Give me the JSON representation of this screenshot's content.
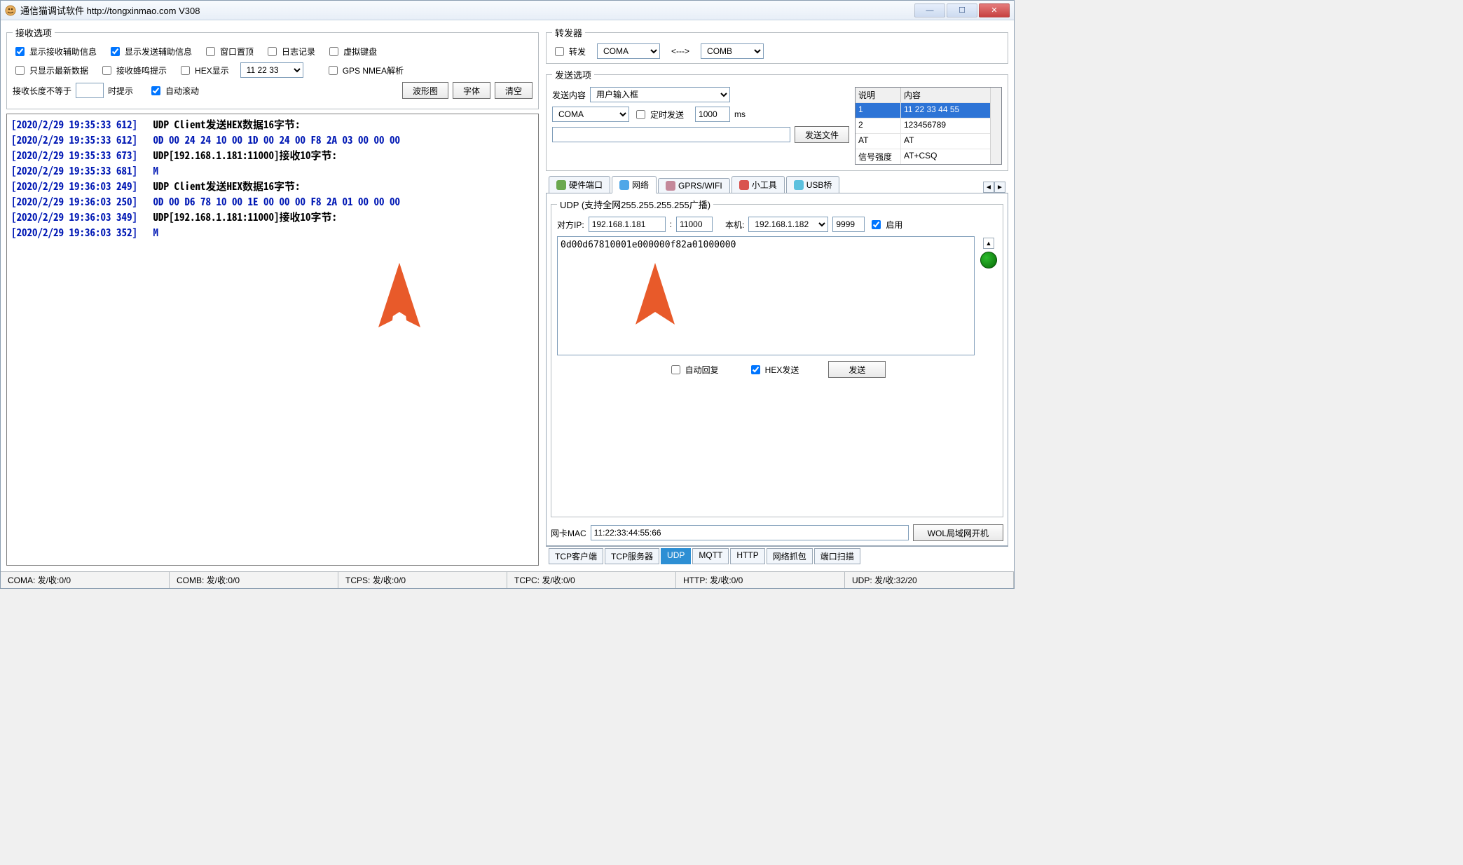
{
  "window": {
    "title": "通信猫调试软件  http://tongxinmao.com  V308"
  },
  "recv_options": {
    "legend": "接收选项",
    "show_recv_aux": "显示接收辅助信息",
    "show_send_aux": "显示发送辅助信息",
    "topmost": "窗口置顶",
    "logrec": "日志记录",
    "virtual_kb": "虚拟键盘",
    "only_newest": "只显示最新数据",
    "recv_beep": "接收蜂鸣提示",
    "hex_disp": "HEX显示",
    "hex_sample": "11 22 33",
    "gps_nmea": "GPS NMEA解析",
    "len_ne_label": "接收长度不等于",
    "len_ne_value": "",
    "len_hint": "时提示",
    "autoscroll": "自动滚动",
    "btn_wave": "波形图",
    "btn_font": "字体",
    "btn_clear": "清空"
  },
  "log_lines": [
    {
      "type": "hdr",
      "ts": "[2020/2/29 19:35:33 612]",
      "text": "UDP Client发送HEX数据16字节:"
    },
    {
      "type": "hex",
      "ts": "[2020/2/29 19:35:33 612]",
      "text": "0D 00 24 24 10 00 1D 00 24 00 F8 2A 03 00 00 00"
    },
    {
      "type": "hdr",
      "ts": "[2020/2/29 19:35:33 673]",
      "text": "UDP[192.168.1.181:11000]接收10字节:"
    },
    {
      "type": "m",
      "ts": "[2020/2/29 19:35:33 681]",
      "text": "M"
    },
    {
      "type": "hdr",
      "ts": "[2020/2/29 19:36:03 249]",
      "text": "UDP Client发送HEX数据16字节:"
    },
    {
      "type": "hex",
      "ts": "[2020/2/29 19:36:03 250]",
      "text": "0D 00 D6 78 10 00 1E 00 00 00 F8 2A 01 00 00 00"
    },
    {
      "type": "hdr",
      "ts": "[2020/2/29 19:36:03 349]",
      "text": "UDP[192.168.1.181:11000]接收10字节:"
    },
    {
      "type": "m",
      "ts": "[2020/2/29 19:36:03 352]",
      "text": "M"
    }
  ],
  "forwarder": {
    "legend": "转发器",
    "enable": "转发",
    "from": "COMA",
    "arrow": "<--->",
    "to": "COMB"
  },
  "send_options": {
    "legend": "发送选项",
    "content_lbl": "发送内容",
    "content_sel": "用户输入框",
    "port_sel": "COMA",
    "timed_lbl": "定时发送",
    "timed_val": "1000",
    "ms": "ms",
    "sendfile_btn": "发送文件",
    "file_input": "",
    "table_header_desc": "说明",
    "table_header_content": "内容",
    "rows": [
      {
        "desc": "1",
        "content": "11 22 33 44 55"
      },
      {
        "desc": "2",
        "content": "123456789"
      },
      {
        "desc": "AT",
        "content": "AT"
      },
      {
        "desc": "信号强度",
        "content": "AT+CSQ"
      }
    ]
  },
  "tabs": {
    "hw": "硬件端口",
    "net": "网络",
    "gprs": "GPRS/WIFI",
    "tool": "小工具",
    "usb": "USB桥"
  },
  "subtabs": {
    "tcpc": "TCP客户端",
    "tcps": "TCP服务器",
    "udp": "UDP",
    "mqtt": "MQTT",
    "http": "HTTP",
    "cap": "网络抓包",
    "scan": "端口扫描"
  },
  "udp": {
    "legend": "UDP (支持全网255.255.255.255广播)",
    "remote_ip_lbl": "对方IP:",
    "remote_ip": "192.168.1.181",
    "remote_port": "11000",
    "local_lbl": "本机:",
    "local_ip": "192.168.1.182",
    "local_port": "9999",
    "enable": "启用",
    "data": "0d00d67810001e000000f82a01000000",
    "auto_reply": "自动回复",
    "hex_send": "HEX发送",
    "send_btn": "发送",
    "mac_lbl": "网卡MAC",
    "mac_val": "11:22:33:44:55:66",
    "wol_btn": "WOL局域网开机"
  },
  "status": {
    "coma": "COMA: 发/收:0/0",
    "comb": "COMB: 发/收:0/0",
    "tcps": "TCPS: 发/收:0/0",
    "tcpc": "TCPC: 发/收:0/0",
    "http": "HTTP: 发/收:0/0",
    "udp": "UDP: 发/收:32/20"
  }
}
